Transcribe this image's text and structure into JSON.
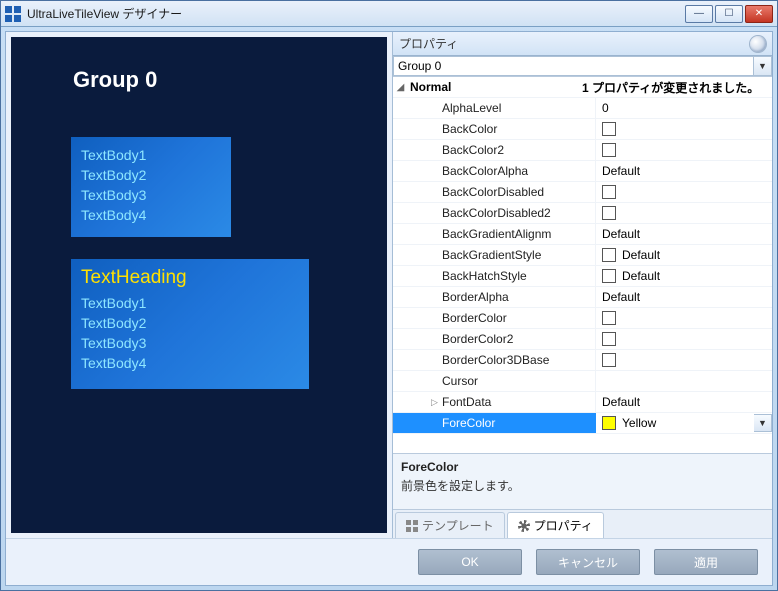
{
  "titlebar": {
    "title": "UltraLiveTileView デザイナー"
  },
  "preview": {
    "group_title": "Group 0",
    "tile1": {
      "lines": [
        "TextBody1",
        "TextBody2",
        "TextBody3",
        "TextBody4"
      ]
    },
    "tile2": {
      "heading": "TextHeading",
      "lines": [
        "TextBody1",
        "TextBody2",
        "TextBody3",
        "TextBody4"
      ]
    }
  },
  "properties": {
    "panel_title": "プロパティ",
    "selector_value": "Group 0",
    "category": {
      "name": "Normal",
      "status": "1 プロパティが変更されました。"
    },
    "rows": [
      {
        "name": "AlphaLevel",
        "value": "0"
      },
      {
        "name": "BackColor",
        "swatch": true
      },
      {
        "name": "BackColor2",
        "swatch": true
      },
      {
        "name": "BackColorAlpha",
        "value": "Default"
      },
      {
        "name": "BackColorDisabled",
        "swatch": true
      },
      {
        "name": "BackColorDisabled2",
        "swatch": true
      },
      {
        "name": "BackGradientAlignm",
        "value": "Default"
      },
      {
        "name": "BackGradientStyle",
        "swatch": true,
        "value": "Default"
      },
      {
        "name": "BackHatchStyle",
        "swatch": true,
        "value": "Default"
      },
      {
        "name": "BorderAlpha",
        "value": "Default"
      },
      {
        "name": "BorderColor",
        "swatch": true
      },
      {
        "name": "BorderColor2",
        "swatch": true
      },
      {
        "name": "BorderColor3DBase",
        "swatch": true
      },
      {
        "name": "Cursor"
      },
      {
        "name": "FontData",
        "value": "Default",
        "expandable": true
      },
      {
        "name": "ForeColor",
        "swatch": true,
        "swatch_color": "yellow",
        "value": "Yellow",
        "selected": true
      }
    ],
    "description": {
      "title": "ForeColor",
      "body": "前景色を設定します。"
    }
  },
  "tabs": {
    "template": "テンプレート",
    "property": "プロパティ"
  },
  "buttons": {
    "ok": "OK",
    "cancel": "キャンセル",
    "apply": "適用"
  }
}
